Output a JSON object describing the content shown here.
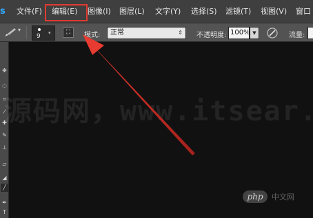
{
  "app": {
    "logo": "s"
  },
  "menu": {
    "items": [
      {
        "label": "文件(F)"
      },
      {
        "label": "编辑(E)"
      },
      {
        "label": "图像(I)"
      },
      {
        "label": "图层(L)"
      },
      {
        "label": "文字(Y)"
      },
      {
        "label": "选择(S)"
      },
      {
        "label": "滤镜(T)"
      },
      {
        "label": "视图(V)"
      },
      {
        "label": "窗口"
      }
    ],
    "highlighted_item": "编辑(E)",
    "highlight_color": "#e03b32"
  },
  "options": {
    "brush_size": "9",
    "mode_label": "模式:",
    "mode_value": "正常",
    "opacity_label": "不透明度:",
    "opacity_value": "100%",
    "flow_label": "流量:"
  },
  "tools": {
    "icons": [
      "move-icon",
      "lasso-icon",
      "crop-icon",
      "eyedropper-icon",
      "healing-icon",
      "brush-icon",
      "stamp-icon",
      "eraser-icon",
      "gradient-icon",
      "smudge-icon",
      "pen-icon",
      "text-icon"
    ]
  },
  "annotation": {
    "arrow_color": "#e03b32"
  },
  "watermark": {
    "text": "源码网，www.itsear.c",
    "badge": "php",
    "badge_suffix": "中文网"
  }
}
